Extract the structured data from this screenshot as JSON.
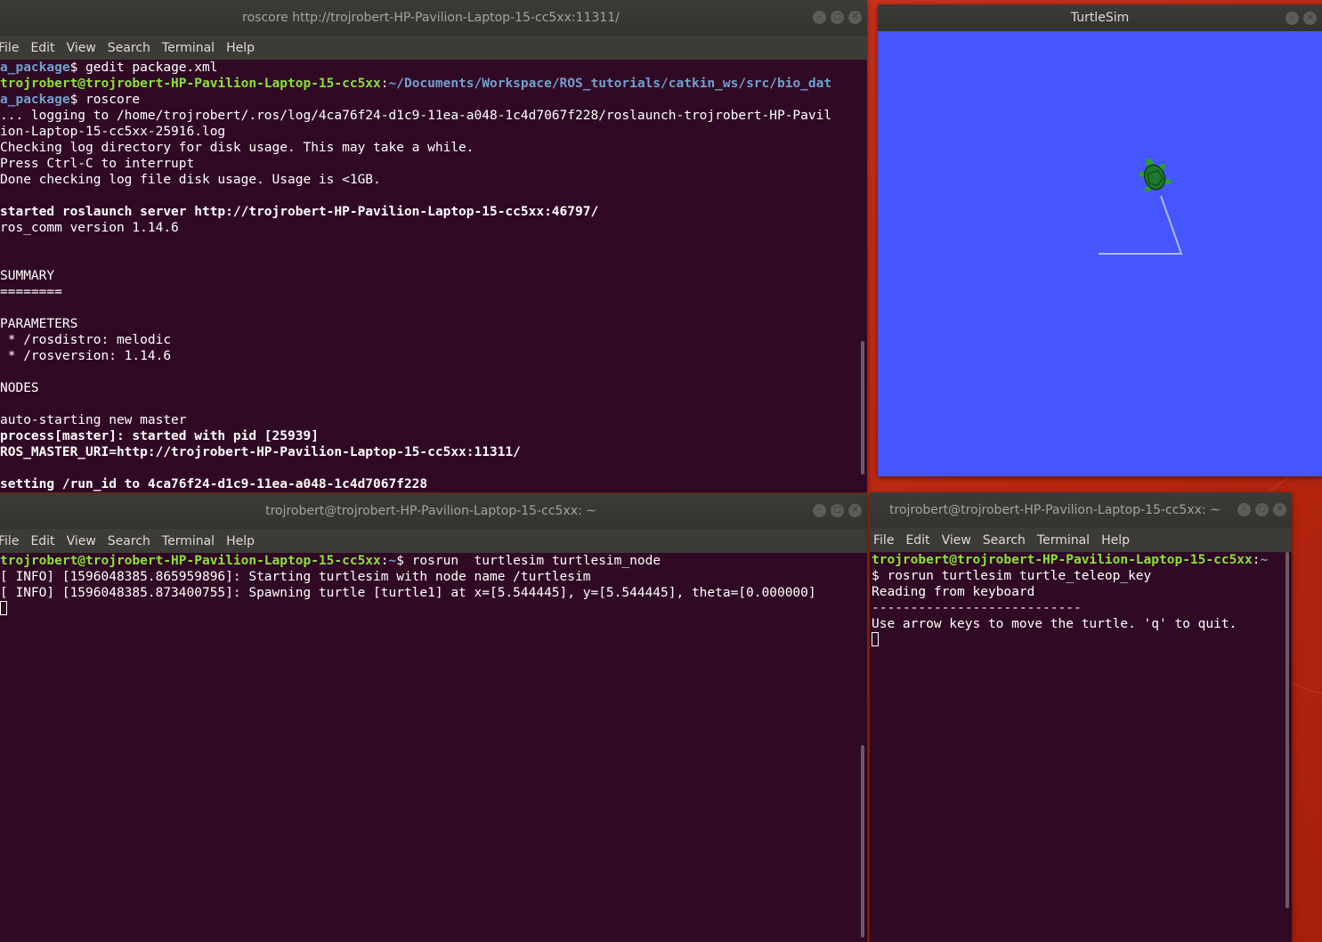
{
  "windows": {
    "roscore": {
      "title": "roscore http://trojrobert-HP-Pavilion-Laptop-15-cc5xx:11311/",
      "menu": [
        "File",
        "Edit",
        "View",
        "Search",
        "Terminal",
        "Help"
      ],
      "lines": [
        {
          "segs": [
            {
              "t": "a_package",
              "c": "b"
            },
            {
              "t": "$ gedit package.xml"
            }
          ]
        },
        {
          "segs": [
            {
              "t": "trojrobert@trojrobert-HP-Pavilion-Laptop-15-cc5xx",
              "c": "g"
            },
            {
              "t": ":"
            },
            {
              "t": "~/Documents/Workspace/ROS_tutorials/catkin_ws/src/bio_dat",
              "c": "b"
            }
          ]
        },
        {
          "segs": [
            {
              "t": "a_package",
              "c": "b"
            },
            {
              "t": "$ roscore"
            }
          ]
        },
        {
          "segs": [
            {
              "t": "... logging to /home/trojrobert/.ros/log/4ca76f24-d1c9-11ea-a048-1c4d7067f228/roslaunch-trojrobert-HP-Pavil"
            }
          ]
        },
        {
          "segs": [
            {
              "t": "ion-Laptop-15-cc5xx-25916.log"
            }
          ]
        },
        {
          "segs": [
            {
              "t": "Checking log directory for disk usage. This may take a while."
            }
          ]
        },
        {
          "segs": [
            {
              "t": "Press Ctrl-C to interrupt"
            }
          ]
        },
        {
          "segs": [
            {
              "t": "Done checking log file disk usage. Usage is <1GB."
            }
          ]
        },
        {
          "segs": [
            {
              "t": ""
            }
          ]
        },
        {
          "segs": [
            {
              "t": "started roslaunch server http://trojrobert-HP-Pavilion-Laptop-15-cc5xx:46797/",
              "c": "bold"
            }
          ]
        },
        {
          "segs": [
            {
              "t": "ros_comm version 1.14.6"
            }
          ]
        },
        {
          "segs": [
            {
              "t": ""
            }
          ]
        },
        {
          "segs": [
            {
              "t": ""
            }
          ]
        },
        {
          "segs": [
            {
              "t": "SUMMARY"
            }
          ]
        },
        {
          "segs": [
            {
              "t": "========"
            }
          ]
        },
        {
          "segs": [
            {
              "t": ""
            }
          ]
        },
        {
          "segs": [
            {
              "t": "PARAMETERS"
            }
          ]
        },
        {
          "segs": [
            {
              "t": " * /rosdistro: melodic"
            }
          ]
        },
        {
          "segs": [
            {
              "t": " * /rosversion: 1.14.6"
            }
          ]
        },
        {
          "segs": [
            {
              "t": ""
            }
          ]
        },
        {
          "segs": [
            {
              "t": "NODES"
            }
          ]
        },
        {
          "segs": [
            {
              "t": ""
            }
          ]
        },
        {
          "segs": [
            {
              "t": "auto-starting new master"
            }
          ]
        },
        {
          "segs": [
            {
              "t": "process[master]: started with pid [25939]",
              "c": "bold"
            }
          ]
        },
        {
          "segs": [
            {
              "t": "ROS_MASTER_URI=http://trojrobert-HP-Pavilion-Laptop-15-cc5xx:11311/",
              "c": "bold"
            }
          ]
        },
        {
          "segs": [
            {
              "t": ""
            }
          ]
        },
        {
          "segs": [
            {
              "t": "setting /run_id to 4ca76f24-d1c9-11ea-a048-1c4d7067f228",
              "c": "bold"
            }
          ]
        }
      ]
    },
    "turtlesim": {
      "title": "TurtleSim",
      "canvas_color": "#4556ff"
    },
    "node": {
      "title": "trojrobert@trojrobert-HP-Pavilion-Laptop-15-cc5xx: ~",
      "menu": [
        "File",
        "Edit",
        "View",
        "Search",
        "Terminal",
        "Help"
      ],
      "lines": [
        {
          "segs": [
            {
              "t": "trojrobert@trojrobert-HP-Pavilion-Laptop-15-cc5xx",
              "c": "g"
            },
            {
              "t": ":"
            },
            {
              "t": "~",
              "c": "b"
            },
            {
              "t": "$ rosrun  turtlesim turtlesim_node"
            }
          ]
        },
        {
          "segs": [
            {
              "t": "[ INFO] [1596048385.865959896]: Starting turtlesim with node name /turtlesim"
            }
          ]
        },
        {
          "segs": [
            {
              "t": "[ INFO] [1596048385.873400755]: Spawning turtle [turtle1] at x=[5.544445], y=[5.544445], theta=[0.000000]"
            }
          ]
        }
      ]
    },
    "teleop": {
      "title": "trojrobert@trojrobert-HP-Pavilion-Laptop-15-cc5xx: ~",
      "menu": [
        "File",
        "Edit",
        "View",
        "Search",
        "Terminal",
        "Help"
      ],
      "lines": [
        {
          "segs": [
            {
              "t": "trojrobert@trojrobert-HP-Pavilion-Laptop-15-cc5xx",
              "c": "g"
            },
            {
              "t": ":"
            },
            {
              "t": "~",
              "c": "b"
            }
          ]
        },
        {
          "segs": [
            {
              "t": "$ rosrun turtlesim turtle_teleop_key"
            }
          ]
        },
        {
          "segs": [
            {
              "t": "Reading from keyboard"
            }
          ]
        },
        {
          "segs": [
            {
              "t": "---------------------------"
            }
          ]
        },
        {
          "segs": [
            {
              "t": "Use arrow keys to move the turtle. 'q' to quit."
            }
          ]
        }
      ]
    }
  },
  "colors": {
    "terminal_bg": "#300a24",
    "prompt_user": "#8ae234",
    "prompt_path": "#729fcf",
    "titlebar": "#3c3b37"
  }
}
